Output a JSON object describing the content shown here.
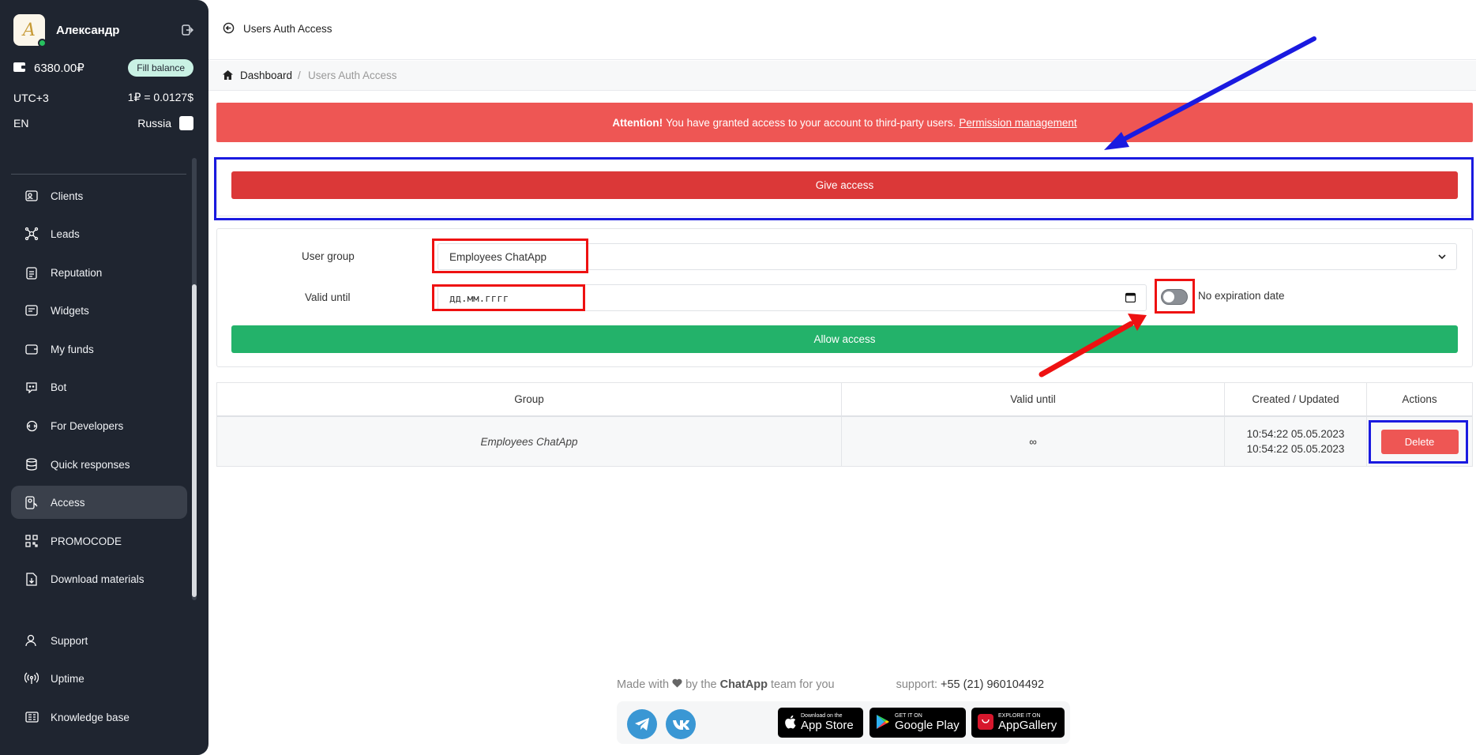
{
  "sidebar": {
    "user_name": "Александр",
    "balance": "6380.00₽",
    "fill_balance_label": "Fill balance",
    "timezone": "UTC+3",
    "rate": "1₽ = 0.0127$",
    "language": "EN",
    "country": "Russia",
    "items": [
      {
        "label": "Clients",
        "icon": "clients-icon"
      },
      {
        "label": "Leads",
        "icon": "leads-icon"
      },
      {
        "label": "Reputation",
        "icon": "reputation-icon"
      },
      {
        "label": "Widgets",
        "icon": "widgets-icon"
      },
      {
        "label": "My funds",
        "icon": "wallet-icon"
      },
      {
        "label": "Bot",
        "icon": "bot-icon"
      },
      {
        "label": "For Developers",
        "icon": "developers-icon"
      },
      {
        "label": "Quick responses",
        "icon": "database-icon"
      },
      {
        "label": "Access",
        "icon": "access-icon",
        "active": true
      },
      {
        "label": "PROMOCODE",
        "icon": "promocode-icon"
      },
      {
        "label": "Download materials",
        "icon": "download-icon"
      }
    ],
    "bottom_items": [
      {
        "label": "Support",
        "icon": "support-icon"
      },
      {
        "label": "Uptime",
        "icon": "uptime-icon"
      },
      {
        "label": "Knowledge base",
        "icon": "knowledge-icon"
      }
    ]
  },
  "header": {
    "title": "Users Auth Access"
  },
  "breadcrumb": {
    "home": "Dashboard",
    "separator": "/",
    "current": "Users Auth Access"
  },
  "alert": {
    "strong": "Attention!",
    "text": "You have granted access to your account to third-party users.",
    "link": "Permission management"
  },
  "give_access_label": "Give access",
  "form": {
    "user_group_label": "User group",
    "user_group_value": "Employees ChatApp",
    "valid_until_label": "Valid until",
    "valid_until_placeholder": "дд.мм.гггг",
    "no_expiration_label": "No expiration date",
    "no_expiration_checked": false,
    "allow_access_label": "Allow access"
  },
  "table": {
    "headers": [
      "Group",
      "Valid until",
      "Created / Updated",
      "Actions"
    ],
    "rows": [
      {
        "group": "Employees ChatApp",
        "valid_until": "∞",
        "created": "10:54:22 05.05.2023",
        "updated": "10:54:22 05.05.2023",
        "action": "Delete"
      }
    ]
  },
  "footer": {
    "made_prefix": "Made with",
    "made_middle": "by the",
    "brand": "ChatApp",
    "made_suffix": "team for you",
    "support_label": "support:",
    "phone": "+55 (21) 960104492",
    "stores": [
      {
        "small": "Download on the",
        "big": "App Store"
      },
      {
        "small": "GET IT ON",
        "big": "Google Play"
      },
      {
        "small": "EXPLORE IT ON",
        "big": "AppGallery"
      }
    ]
  },
  "colors": {
    "sidebar_bg": "#1f2530",
    "alert_red": "#ee5654",
    "give_access_red": "#db3838",
    "allow_green": "#23b26a",
    "annotation_red": "#ee1111",
    "annotation_blue": "#1a1ae0"
  }
}
